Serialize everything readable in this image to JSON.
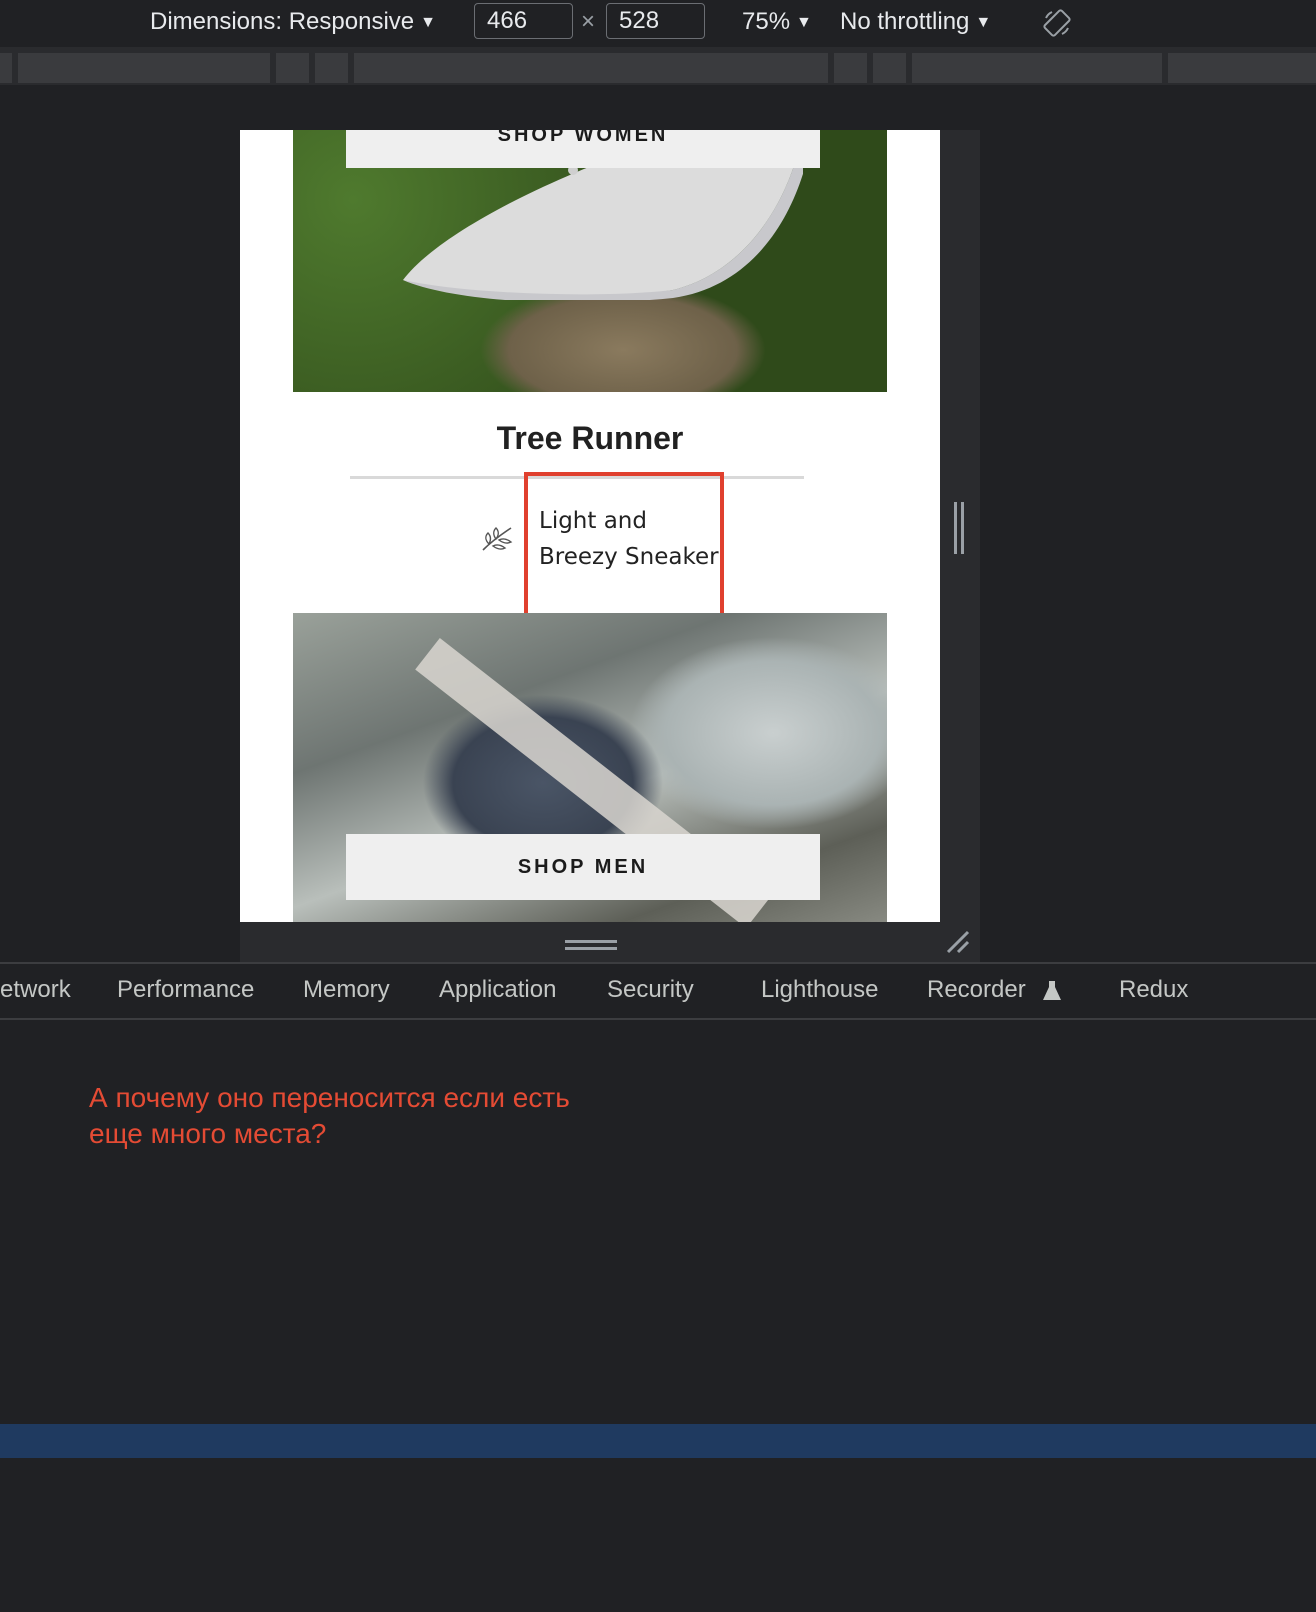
{
  "toolbar": {
    "dimensions_label": "Dimensions: Responsive",
    "width_value": "466",
    "times_sign": "×",
    "height_value": "528",
    "zoom": "75%",
    "throttling": "No throttling"
  },
  "page": {
    "shop_women": "SHOP WOMEN",
    "product_title": "Tree Runner",
    "tagline": "Light and Breezy Sneaker",
    "shop_men": "SHOP MEN"
  },
  "devtools": {
    "tabs": [
      "etwork",
      "Performance",
      "Memory",
      "Application",
      "Security",
      "Lighthouse",
      "Recorder",
      "Redux"
    ]
  },
  "annotation": {
    "text": "А почему оно переносится если есть\nеще  много места?",
    "color": "#e44b34"
  },
  "icons": [
    "caret-down-icon",
    "rotate-icon",
    "leaf-icon",
    "flask-icon",
    "resize-corner-icon"
  ]
}
